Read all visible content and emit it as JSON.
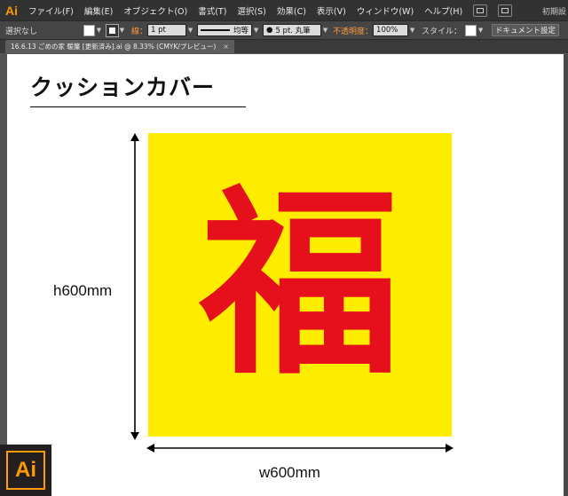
{
  "app": {
    "logo": "Ai",
    "brand_color": "#ff9a00",
    "workspace": "初期設"
  },
  "menubar": {
    "items": [
      "ファイル(F)",
      "編集(E)",
      "オブジェクト(O)",
      "書式(T)",
      "選択(S)",
      "効果(C)",
      "表示(V)",
      "ウィンドウ(W)",
      "ヘルプ(H)"
    ]
  },
  "controlbar": {
    "selection": "選択なし",
    "stroke_label": "線：",
    "stroke_weight": "1 pt",
    "stroke_profile": "均等",
    "brush": "5 pt. 丸筆",
    "opacity_label": "不透明度：",
    "opacity_value": "100%",
    "style_label": "スタイル：",
    "doc_setup": "ドキュメント設定"
  },
  "tab": {
    "title": "16.6.13 ごめの家 暖簾 [更新済み].ai @ 8.33% (CMYK/プレビュー)",
    "close": "×"
  },
  "artboard": {
    "title": "クッションカバー",
    "kanji": "福",
    "cushion_color": "#ffed00",
    "kanji_color": "#e5101c",
    "height_label": "h600mm",
    "width_label": "w600mm"
  },
  "badge": {
    "text": "Ai"
  }
}
